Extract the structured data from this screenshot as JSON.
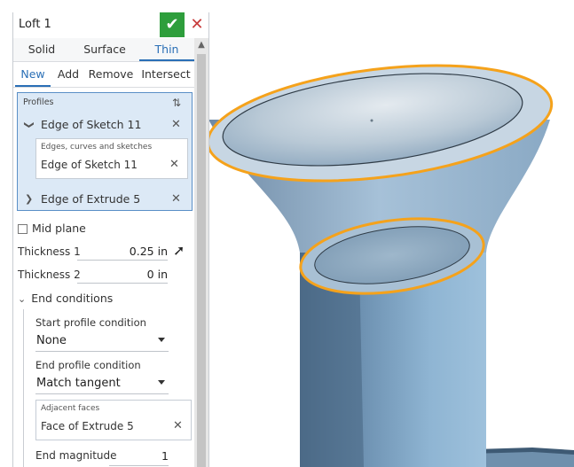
{
  "feature_dialog": {
    "title": "Loft 1",
    "confirm_icon": "check-icon",
    "cancel_icon": "close-icon",
    "type_tabs": [
      {
        "label": "Solid",
        "active": false
      },
      {
        "label": "Surface",
        "active": false
      },
      {
        "label": "Thin",
        "active": true
      }
    ],
    "operation_tabs": [
      {
        "label": "New",
        "active": true
      },
      {
        "label": "Add",
        "active": false
      },
      {
        "label": "Remove",
        "active": false
      },
      {
        "label": "Intersect",
        "active": false
      }
    ],
    "profiles": {
      "label": "Profiles",
      "items": [
        {
          "label": "Edge of Sketch 11",
          "expanded": true,
          "sub_label": "Edges, curves and sketches",
          "sub_value": "Edge of Sketch 11"
        },
        {
          "label": "Edge of Extrude 5",
          "expanded": false
        }
      ]
    },
    "mid_plane": {
      "label": "Mid plane",
      "checked": false
    },
    "thickness1": {
      "label": "Thickness 1",
      "value": "0.25 in"
    },
    "thickness2": {
      "label": "Thickness 2",
      "value": "0 in"
    },
    "end_conditions": {
      "label": "End conditions",
      "start_label": "Start profile condition",
      "start_value": "None",
      "end_label": "End profile condition",
      "end_value": "Match tangent",
      "adjacent_label": "Adjacent faces",
      "adjacent_value": "Face of Extrude 5",
      "magnitude_label": "End magnitude",
      "magnitude_value": "1"
    }
  },
  "colors": {
    "accent": "#2a6fb6",
    "confirm": "#2e9e3c",
    "cancel": "#c73a3a",
    "selection_highlight": "#f5a21b",
    "model": "#8fb3cf"
  }
}
